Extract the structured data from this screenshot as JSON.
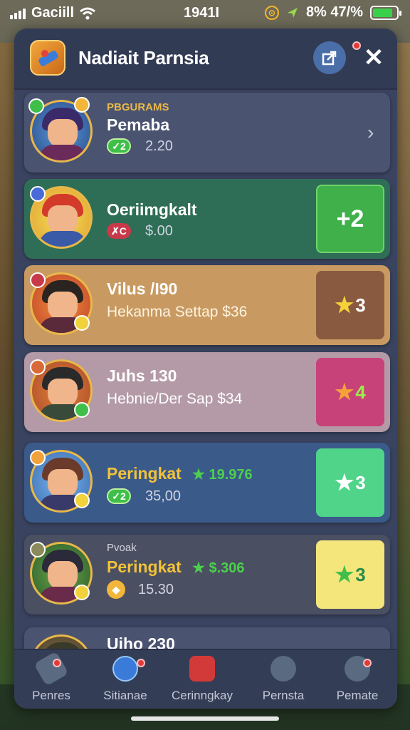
{
  "status_bar": {
    "carrier": "Gaciill",
    "time": "1941I",
    "battery_text": "8% 47/%",
    "battery_fill_fraction": 0.85
  },
  "header": {
    "title": "Nadiait Parnsia"
  },
  "rows": [
    {
      "subtitle": "PBGURAMS",
      "name": "Pemaba",
      "badge": "✓2",
      "value": "2.20",
      "action": ""
    },
    {
      "subtitle": "",
      "name": "Oeriimgkalt",
      "badge": "✗C",
      "value": "$.00",
      "action": "+2"
    },
    {
      "subtitle": "",
      "name": "Vilus /I90",
      "line2": "Hekanma Settap $36",
      "action": "3"
    },
    {
      "subtitle": "",
      "name": "Juhs 130",
      "line2": "Hebnie/Der Sap $34",
      "action": "4"
    },
    {
      "subtitle": "",
      "name": "Peringkat",
      "green": "19.976",
      "badge": "✓2",
      "value": "35,00",
      "action": "3"
    },
    {
      "subtitle": "Pvoak",
      "name": "Peringkat",
      "green": "$.306",
      "badge": "",
      "value": "15.30",
      "action": "3"
    },
    {
      "subtitle": "",
      "name": "Uiho 230"
    }
  ],
  "nav": [
    {
      "label": "Penres"
    },
    {
      "label": "Sitianae"
    },
    {
      "label": "Cerinngkay"
    },
    {
      "label": "Pernsta"
    },
    {
      "label": "Pemate"
    }
  ],
  "colors": {
    "panel": "#3a4460",
    "accent_gold": "#e8b84a",
    "green": "#3fbf4a",
    "brown": "#8a5a3a",
    "magenta": "#c8427a",
    "mint": "#4fd48a",
    "yellow": "#f4e67a"
  }
}
